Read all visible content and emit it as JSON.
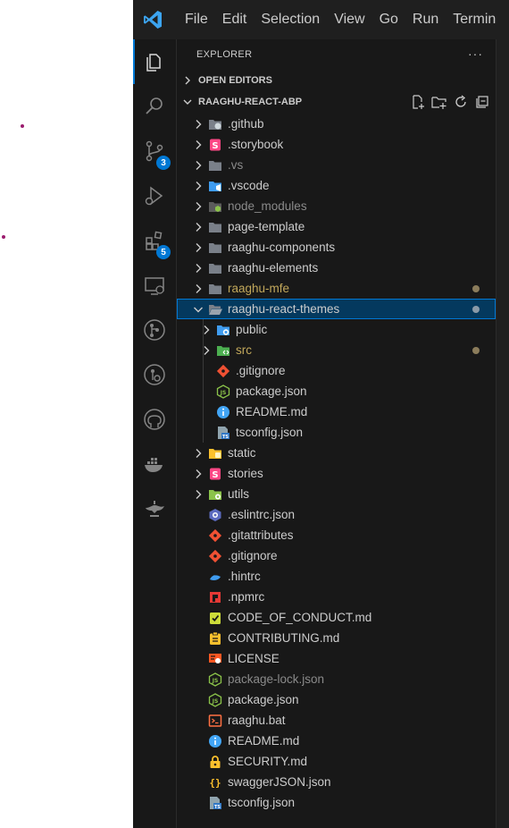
{
  "titlebar": {
    "menu": [
      "File",
      "Edit",
      "Selection",
      "View",
      "Go",
      "Run",
      "Termin"
    ]
  },
  "activity_bar": [
    {
      "name": "explorer-icon",
      "active": true
    },
    {
      "name": "search-icon"
    },
    {
      "name": "source-control-icon",
      "badge": "3"
    },
    {
      "name": "run-debug-icon"
    },
    {
      "name": "extensions-icon",
      "badge": "5"
    },
    {
      "name": "remote-explorer-icon"
    },
    {
      "name": "gitlens-icon"
    },
    {
      "name": "gitlens-inspect-icon"
    },
    {
      "name": "github-icon"
    },
    {
      "name": "docker-icon"
    },
    {
      "name": "lamp-icon"
    }
  ],
  "explorer": {
    "title": "EXPLORER",
    "more": "···",
    "open_editors": "OPEN EDITORS",
    "project": "RAAGHU-REACT-ABP",
    "items": [
      {
        "label": ".github",
        "type": "folder",
        "icon": "github-folder-icon",
        "color": "#7a8089",
        "depth": 0,
        "expanded": false
      },
      {
        "label": ".storybook",
        "type": "folder",
        "icon": "storybook-folder-icon",
        "color": "#ff4785",
        "depth": 0,
        "expanded": false
      },
      {
        "label": ".vs",
        "type": "folder",
        "icon": "folder-icon",
        "color": "#7a8089",
        "depth": 0,
        "expanded": false,
        "style": "dim"
      },
      {
        "label": ".vscode",
        "type": "folder",
        "icon": "vscode-folder-icon",
        "color": "#3f9cf0",
        "depth": 0,
        "expanded": false
      },
      {
        "label": "node_modules",
        "type": "folder",
        "icon": "node-folder-icon",
        "color": "#8bc34a",
        "depth": 0,
        "expanded": false,
        "style": "dim"
      },
      {
        "label": "page-template",
        "type": "folder",
        "icon": "folder-icon",
        "color": "#7a8089",
        "depth": 0,
        "expanded": false
      },
      {
        "label": "raaghu-components",
        "type": "folder",
        "icon": "folder-icon",
        "color": "#7a8089",
        "depth": 0,
        "expanded": false
      },
      {
        "label": "raaghu-elements",
        "type": "folder",
        "icon": "folder-icon",
        "color": "#7a8089",
        "depth": 0,
        "expanded": false
      },
      {
        "label": "raaghu-mfe",
        "type": "folder",
        "icon": "folder-icon",
        "color": "#7a8089",
        "depth": 0,
        "expanded": false,
        "style": "olive",
        "modified": "#8b7c5b"
      },
      {
        "label": "raaghu-react-themes",
        "type": "folder",
        "icon": "folder-open-icon",
        "color": "#7a8089",
        "depth": 0,
        "expanded": true,
        "selected": true,
        "modified": "#8a9aa8"
      },
      {
        "label": "public",
        "type": "folder",
        "icon": "public-folder-icon",
        "color": "#3f9cf0",
        "depth": 1,
        "expanded": false
      },
      {
        "label": "src",
        "type": "folder",
        "icon": "src-folder-icon",
        "color": "#4caf50",
        "depth": 1,
        "expanded": false,
        "style": "olive",
        "modified": "#8b7c5b"
      },
      {
        "label": ".gitignore",
        "type": "file",
        "icon": "git-file-icon",
        "color": "#f05133",
        "depth": 1
      },
      {
        "label": "package.json",
        "type": "file",
        "icon": "nodejs-file-icon",
        "color": "#8bc34a",
        "depth": 1
      },
      {
        "label": "README.md",
        "type": "file",
        "icon": "info-file-icon",
        "color": "#42a5f5",
        "depth": 1
      },
      {
        "label": "tsconfig.json",
        "type": "file",
        "icon": "tsconfig-file-icon",
        "color": "#3178c6",
        "depth": 1
      },
      {
        "label": "static",
        "type": "folder",
        "icon": "static-folder-icon",
        "color": "#fbc02d",
        "depth": 0,
        "expanded": false
      },
      {
        "label": "stories",
        "type": "folder",
        "icon": "storybook-folder-icon",
        "color": "#ff4785",
        "depth": 0,
        "expanded": false
      },
      {
        "label": "utils",
        "type": "folder",
        "icon": "utils-folder-icon",
        "color": "#8bc34a",
        "depth": 0,
        "expanded": false
      },
      {
        "label": ".eslintrc.json",
        "type": "file",
        "icon": "eslint-file-icon",
        "color": "#5c6bc0",
        "depth": 0
      },
      {
        "label": ".gitattributes",
        "type": "file",
        "icon": "git-file-icon",
        "color": "#f05133",
        "depth": 0
      },
      {
        "label": ".gitignore",
        "type": "file",
        "icon": "git-file-icon",
        "color": "#f05133",
        "depth": 0
      },
      {
        "label": ".hintrc",
        "type": "file",
        "icon": "hint-file-icon",
        "color": "#3f9cf0",
        "depth": 0
      },
      {
        "label": ".npmrc",
        "type": "file",
        "icon": "npm-file-icon",
        "color": "#e53935",
        "depth": 0
      },
      {
        "label": "CODE_OF_CONDUCT.md",
        "type": "file",
        "icon": "conduct-file-icon",
        "color": "#cddc39",
        "depth": 0
      },
      {
        "label": "CONTRIBUTING.md",
        "type": "file",
        "icon": "contributing-file-icon",
        "color": "#fbc02d",
        "depth": 0
      },
      {
        "label": "LICENSE",
        "type": "file",
        "icon": "license-file-icon",
        "color": "#ff5722",
        "depth": 0
      },
      {
        "label": "package-lock.json",
        "type": "file",
        "icon": "nodejs-file-icon",
        "color": "#8bc34a",
        "depth": 0,
        "style": "dim"
      },
      {
        "label": "package.json",
        "type": "file",
        "icon": "nodejs-file-icon",
        "color": "#8bc34a",
        "depth": 0
      },
      {
        "label": "raaghu.bat",
        "type": "file",
        "icon": "bat-file-icon",
        "color": "#ff7043",
        "depth": 0
      },
      {
        "label": "README.md",
        "type": "file",
        "icon": "info-file-icon",
        "color": "#42a5f5",
        "depth": 0
      },
      {
        "label": "SECURITY.md",
        "type": "file",
        "icon": "lock-file-icon",
        "color": "#fbc02d",
        "depth": 0
      },
      {
        "label": "swaggerJSON.json",
        "type": "file",
        "icon": "json-file-icon",
        "color": "#fbc02d",
        "depth": 0
      },
      {
        "label": "tsconfig.json",
        "type": "file",
        "icon": "tsconfig-file-icon",
        "color": "#3178c6",
        "depth": 0
      }
    ]
  }
}
